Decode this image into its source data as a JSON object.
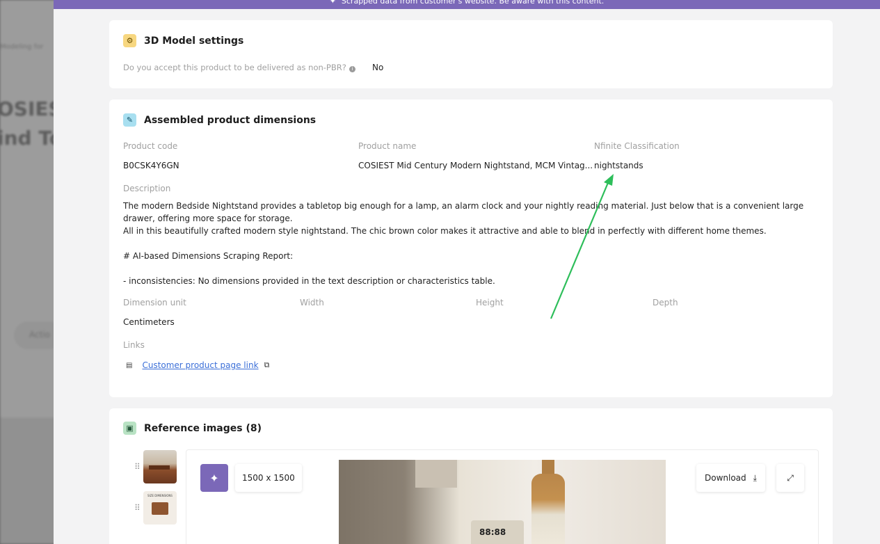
{
  "background": {
    "breadcrumb": "Modeling for",
    "title_line1": "OSIEST",
    "title_line2": "ind To",
    "action_label": "Actio"
  },
  "banner": {
    "text": "Scrapped data from customer's website. Be aware with this content."
  },
  "settings": {
    "title": "3D Model settings",
    "question": "Do you accept this product to be delivered as non-PBR?",
    "answer": "No"
  },
  "dimensions": {
    "title": "Assembled product dimensions",
    "product_code_label": "Product code",
    "product_code": "B0CSK4Y6GN",
    "product_name_label": "Product name",
    "product_name": "COSIEST Mid Century Modern Nightstand, MCM Vintag...",
    "classification_label": "Nfinite Classification",
    "classification": "nightstands",
    "description_label": "Description",
    "description_lines": [
      "The modern Bedside Nightstand provides a tabletop big enough for a lamp, an alarm clock and your nightly reading material. Just below that is a convenient large drawer, offering more space for storage.",
      "All in this beautifully crafted modern style nightstand. The chic brown color makes it attractive and able to blend in perfectly with different home themes.",
      "",
      "# AI-based Dimensions Scraping Report:",
      "",
      "- inconsistencies: No dimensions provided in the text description or characteristics table."
    ],
    "unit_label": "Dimension unit",
    "unit": "Centimeters",
    "width_label": "Width",
    "height_label": "Height",
    "depth_label": "Depth",
    "links_label": "Links",
    "link_text": "Customer product page link"
  },
  "reference_images": {
    "title": "Reference images (8)",
    "resolution": "1500 x 1500",
    "download_label": "Download"
  },
  "icons": {
    "banner": "sparkle-icon",
    "settings": "gear-icon",
    "dimensions": "ruler-icon",
    "images": "image-icon",
    "link": "store-icon",
    "external": "external-link-icon",
    "download": "download-icon",
    "expand": "expand-icon"
  },
  "colors": {
    "accent": "#7b68b8",
    "link": "#3b6fd8",
    "annotation_arrow": "#2dbe5a"
  }
}
